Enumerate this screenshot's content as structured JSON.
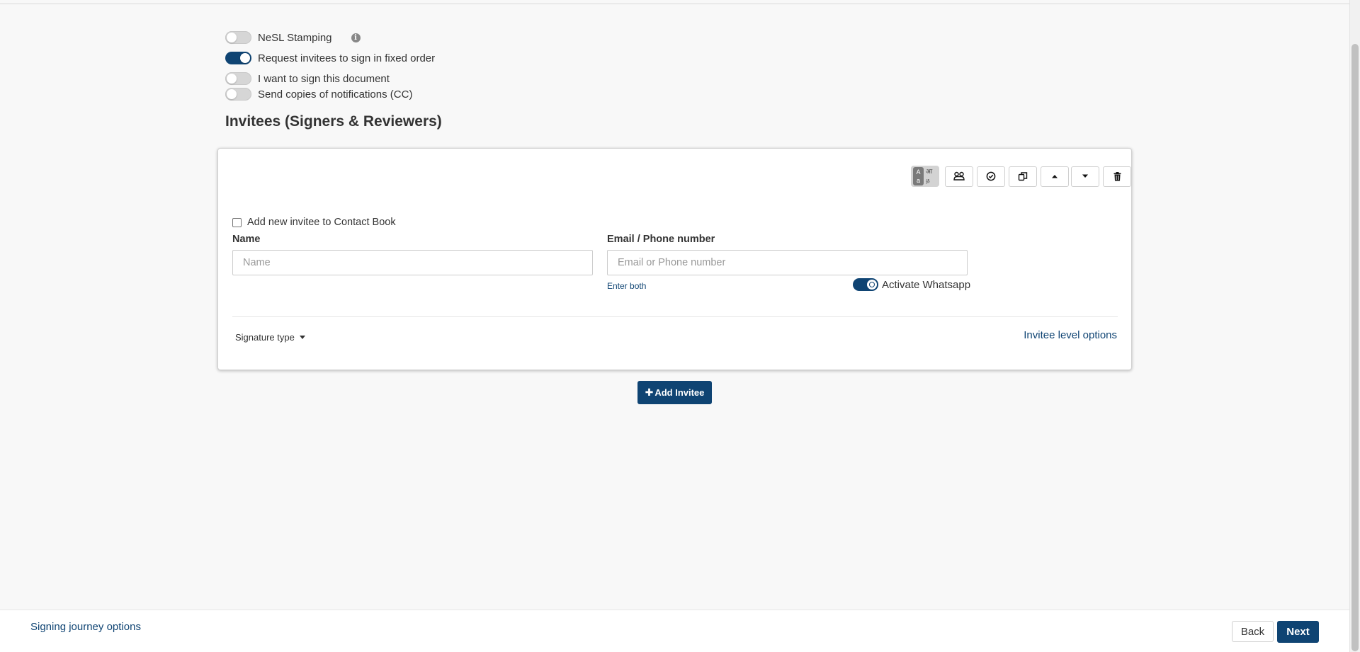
{
  "settings": {
    "nesl_stamping": {
      "label": "NeSL Stamping",
      "enabled": false
    },
    "fixed_order": {
      "label": "Request invitees to sign in fixed order",
      "enabled": true
    },
    "self_sign": {
      "label": "I want to sign this document",
      "enabled": false
    },
    "cc_notifications": {
      "label": "Send copies of notifications (CC)",
      "enabled": false
    }
  },
  "section": {
    "title": "Invitees (Signers & Reviewers)"
  },
  "invitee_card": {
    "toolbar": {
      "language_icon": "language-switch-icon",
      "icons": [
        "group-icon",
        "check-circle-icon",
        "copy-icon",
        "move-up-icon",
        "move-down-icon",
        "delete-icon"
      ]
    },
    "add_to_contact_book": {
      "label": "Add new invitee to Contact Book",
      "checked": false
    },
    "name": {
      "label": "Name",
      "value": "",
      "placeholder": "Name"
    },
    "email_phone": {
      "label": "Email / Phone number",
      "value": "",
      "placeholder": "Email or Phone number"
    },
    "enter_both": "Enter both",
    "whatsapp": {
      "label": "Activate Whatsapp",
      "enabled": true
    },
    "signature_type": "Signature type",
    "invitee_level_options": "Invitee level options"
  },
  "add_invitee": {
    "icon": "plus",
    "label": "Add Invitee"
  },
  "footer": {
    "signing_journey_options": "Signing journey options",
    "back": "Back",
    "next": "Next"
  },
  "colors": {
    "primary": "#0f4473",
    "background": "#f8f8f8"
  }
}
